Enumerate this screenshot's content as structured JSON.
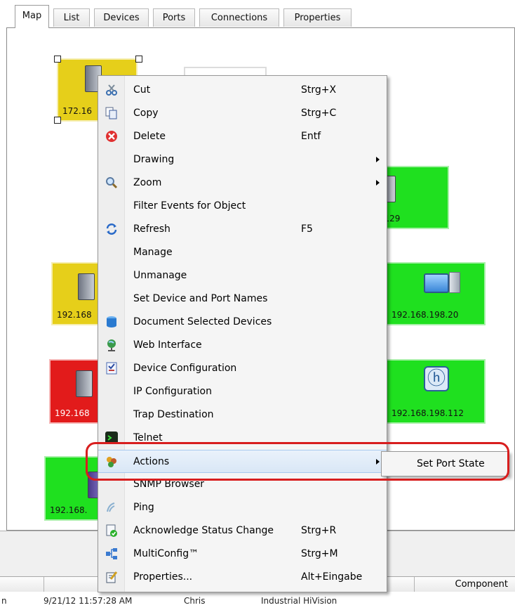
{
  "tabs": [
    "Map",
    "List",
    "Devices",
    "Ports",
    "Connections",
    "Properties"
  ],
  "map": {
    "nodes": [
      {
        "ip": "172.16",
        "status": "yellow",
        "icon": "switch-icon",
        "selected": true
      },
      {
        "ip": "7.129",
        "status": "green",
        "icon": "switch-icon"
      },
      {
        "ip": "192.168",
        "status": "yellow",
        "icon": "switch-icon"
      },
      {
        "ip": "192.168.198.20",
        "status": "green",
        "icon": "pc-icon"
      },
      {
        "ip": "192.168",
        "status": "red",
        "icon": "switch-icon"
      },
      {
        "ip": "192.168.198.112",
        "status": "green",
        "icon": "hivision-logo-icon"
      },
      {
        "ip": "192.168.",
        "status": "green",
        "icon": "device-icon"
      }
    ]
  },
  "context_menu": {
    "items": [
      {
        "label": "Cut",
        "shortcut": "Strg+X",
        "icon": "scissors-icon"
      },
      {
        "label": "Copy",
        "shortcut": "Strg+C",
        "icon": "copy-icon"
      },
      {
        "label": "Delete",
        "shortcut": "Entf",
        "icon": "delete-icon"
      },
      {
        "label": "Drawing",
        "shortcut": "",
        "icon": "",
        "submenu": true
      },
      {
        "label": "Zoom",
        "shortcut": "",
        "icon": "magnifier-icon",
        "submenu": true
      },
      {
        "label": "Filter Events for Object",
        "shortcut": "",
        "icon": ""
      },
      {
        "label": "Refresh",
        "shortcut": "F5",
        "icon": "refresh-icon"
      },
      {
        "label": "Manage",
        "shortcut": "",
        "icon": ""
      },
      {
        "label": "Unmanage",
        "shortcut": "",
        "icon": ""
      },
      {
        "label": "Set Device and Port Names",
        "shortcut": "",
        "icon": ""
      },
      {
        "label": "Document Selected Devices",
        "shortcut": "",
        "icon": "database-icon"
      },
      {
        "label": "Web Interface",
        "shortcut": "",
        "icon": "globe-icon"
      },
      {
        "label": "Device Configuration",
        "shortcut": "",
        "icon": "checklist-icon"
      },
      {
        "label": "IP Configuration",
        "shortcut": "",
        "icon": ""
      },
      {
        "label": "Trap Destination",
        "shortcut": "",
        "icon": ""
      },
      {
        "label": "Telnet",
        "shortcut": "",
        "icon": "terminal-icon"
      },
      {
        "label": "Actions",
        "shortcut": "",
        "icon": "actions-icon",
        "submenu": true,
        "highlighted": true
      },
      {
        "label": "SNMP Browser",
        "shortcut": "",
        "icon": ""
      },
      {
        "label": "Ping",
        "shortcut": "",
        "icon": "ping-icon"
      },
      {
        "label": "Acknowledge Status Change",
        "shortcut": "Strg+R",
        "icon": "acknowledge-icon"
      },
      {
        "label": "MultiConfig™",
        "shortcut": "Strg+M",
        "icon": "multiconfig-icon"
      },
      {
        "label": "Properties...",
        "shortcut": "Alt+Eingabe",
        "icon": "properties-icon"
      }
    ]
  },
  "submenu": {
    "items": [
      "Set Port State"
    ]
  },
  "table": {
    "column_header": "Component"
  },
  "status": {
    "left_fragment": "n",
    "timestamp": "9/21/12 11:57:28 AM",
    "user": "Chris",
    "component": "Industrial HiVision"
  },
  "colors": {
    "device_ok": "#1fe01f",
    "device_warning": "#e6cf1a",
    "device_error": "#e21b1b",
    "highlight_ring": "#d81e1e"
  }
}
